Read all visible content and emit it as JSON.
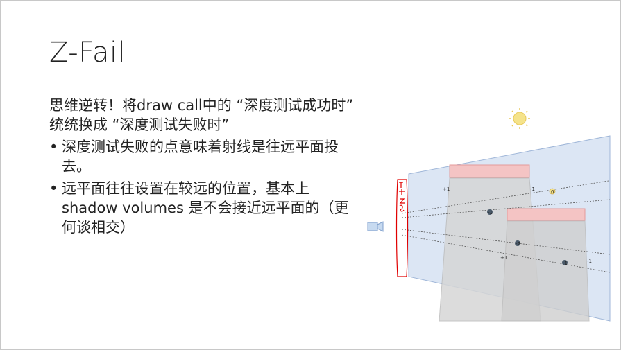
{
  "slide": {
    "title": "Z-Fail",
    "intro": "思维逆转！将draw call中的 “深度测试成功时” 统统换成 “深度测试失败时”",
    "bullets": [
      "深度测试失败的点意味着射线是往远平面投去。",
      "远平面往往设置在较远的位置，基本上 shadow volumes 是不会接近远平面的（更何谈相交）"
    ]
  },
  "diagram": {
    "counters": [
      "+1",
      "-1",
      "0",
      "-1",
      "-2",
      "+1",
      "-1",
      "-1"
    ],
    "colors": {
      "frustum": "#dce6f4",
      "occluder": "#f4c4c4",
      "shadow": "#d3d3d3",
      "sun": "#f5e38a",
      "camera": "#c7daf0",
      "annotation": "#e00000"
    },
    "icons": [
      "sun-icon",
      "camera-icon"
    ]
  }
}
